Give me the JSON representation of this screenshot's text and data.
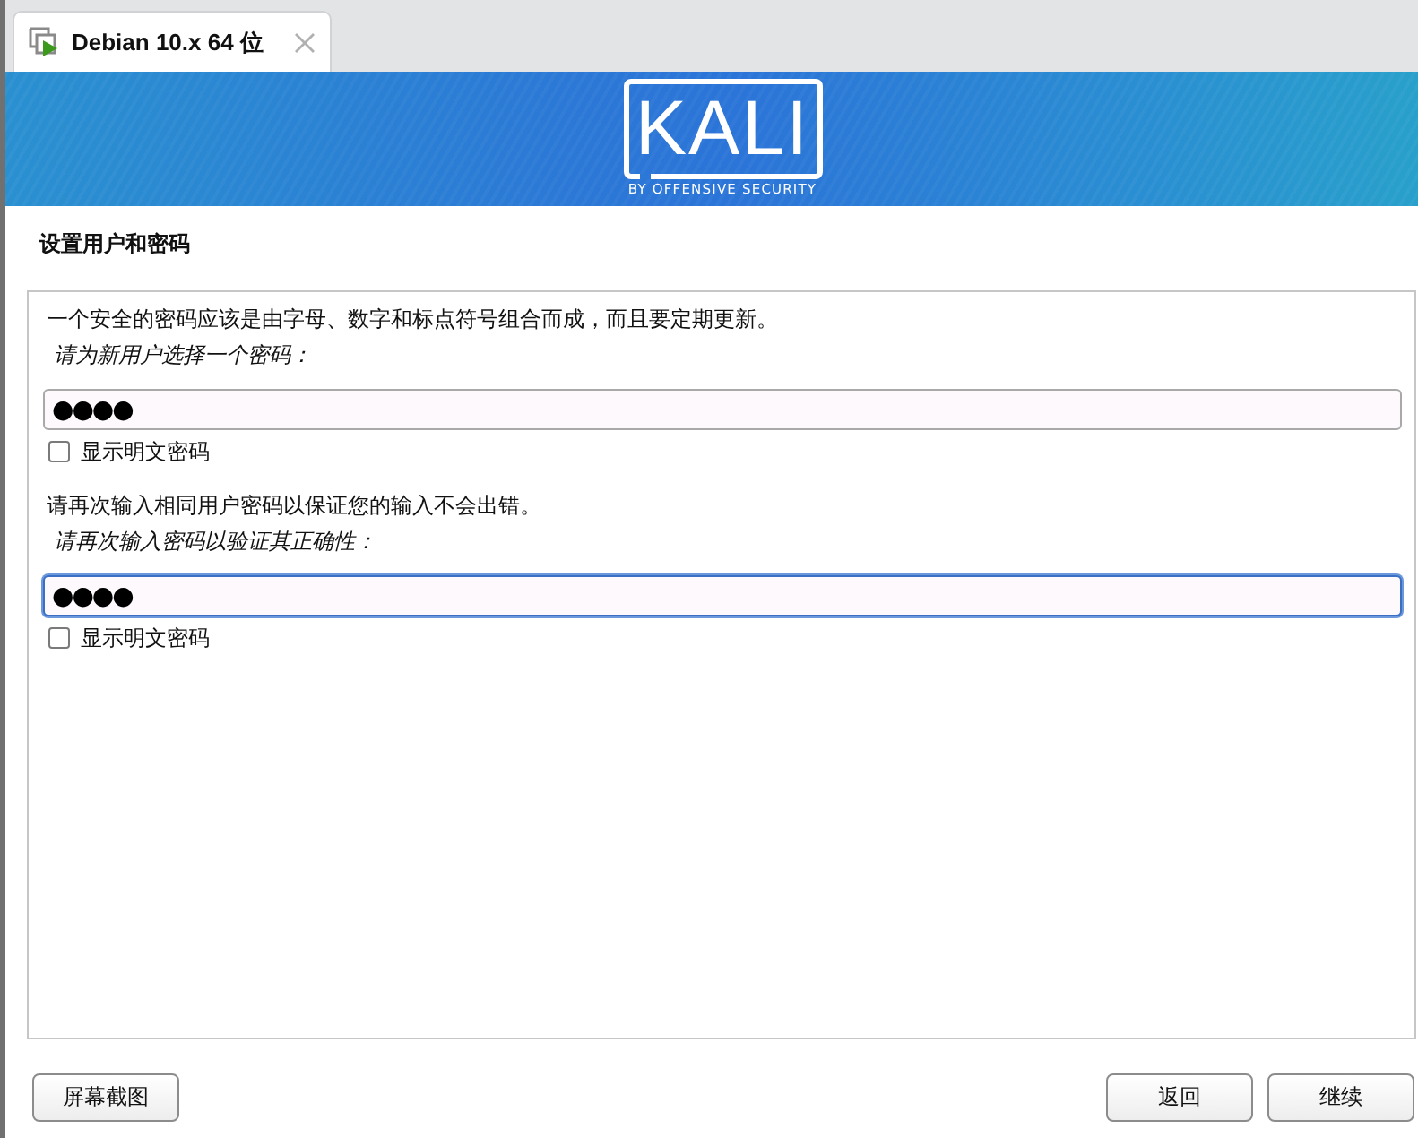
{
  "tab": {
    "title": "Debian 10.x 64 位",
    "selected": true
  },
  "banner": {
    "logo": "KALI",
    "tagline": "BY OFFENSIVE SECURITY"
  },
  "page_title": "设置用户和密码",
  "sections": [
    {
      "description": "一个安全的密码应该是由字母、数字和标点符号组合而成，而且要定期更新。",
      "prompt": "请为新用户选择一个密码：",
      "field": {
        "value": "●●●●",
        "focused": false
      },
      "show_password": {
        "label": "显示明文密码",
        "checked": false
      }
    },
    {
      "description": "请再次输入相同用户密码以保证您的输入不会出错。",
      "prompt": "请再次输入密码以验证其正确性：",
      "field": {
        "value": "●●●●",
        "focused": true
      },
      "show_password": {
        "label": "显示明文密码",
        "checked": false
      }
    }
  ],
  "footer": {
    "left_buttons": [
      {
        "label": "屏幕截图"
      }
    ],
    "right_buttons": [
      {
        "label": "返回"
      },
      {
        "label": "继续"
      }
    ]
  }
}
